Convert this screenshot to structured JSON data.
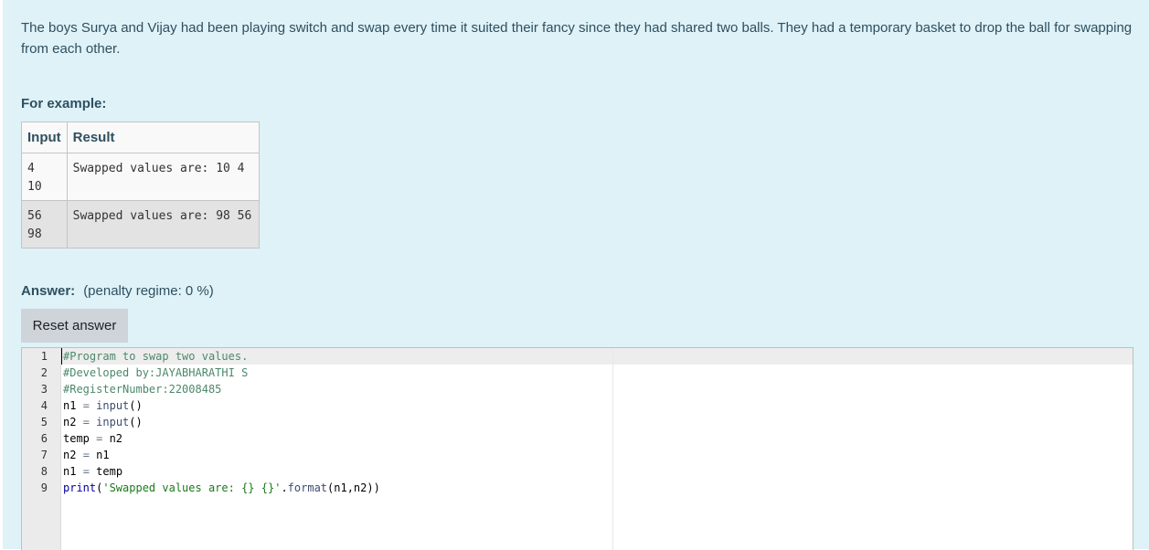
{
  "question": {
    "text": "The boys Surya and Vijay had been playing switch and swap every time it suited their fancy since they had shared two balls. They had a temporary basket to drop the ball for swapping from each other."
  },
  "examples": {
    "heading": "For example:",
    "col_input": "Input",
    "col_result": "Result",
    "rows": [
      {
        "input": "4\n10",
        "result": "Swapped values are: 10 4"
      },
      {
        "input": "56\n98",
        "result": "Swapped values are: 98 56"
      }
    ]
  },
  "answer": {
    "label": "Answer:",
    "penalty": "(penalty regime: 0 %)",
    "reset_label": "Reset answer"
  },
  "editor": {
    "lines": [
      {
        "num": "1",
        "tokens": [
          [
            "tk-comment",
            "#Program to swap two values."
          ]
        ]
      },
      {
        "num": "2",
        "tokens": [
          [
            "tk-comment",
            "#Developed by:JAYABHARATHI S"
          ]
        ]
      },
      {
        "num": "3",
        "tokens": [
          [
            "tk-comment",
            "#RegisterNumber:22008485"
          ]
        ]
      },
      {
        "num": "4",
        "tokens": [
          [
            "",
            "n1 "
          ],
          [
            "tk-op",
            "="
          ],
          [
            "",
            " "
          ],
          [
            "tk-builtin",
            "input"
          ],
          [
            "",
            "()"
          ]
        ]
      },
      {
        "num": "5",
        "tokens": [
          [
            "",
            "n2 "
          ],
          [
            "tk-op",
            "="
          ],
          [
            "",
            " "
          ],
          [
            "tk-builtin",
            "input"
          ],
          [
            "",
            "()"
          ]
        ]
      },
      {
        "num": "6",
        "tokens": [
          [
            "",
            "temp "
          ],
          [
            "tk-op",
            "="
          ],
          [
            "",
            " n2"
          ]
        ]
      },
      {
        "num": "7",
        "tokens": [
          [
            "",
            "n2 "
          ],
          [
            "tk-op",
            "="
          ],
          [
            "",
            " n1"
          ]
        ]
      },
      {
        "num": "8",
        "tokens": [
          [
            "",
            "n1 "
          ],
          [
            "tk-op",
            "="
          ],
          [
            "",
            " temp"
          ]
        ]
      },
      {
        "num": "9",
        "tokens": [
          [
            "tk-kw",
            "print"
          ],
          [
            "",
            "("
          ],
          [
            "tk-str",
            "'Swapped values are: {} {}'"
          ],
          [
            "",
            "."
          ],
          [
            "tk-fn",
            "format"
          ],
          [
            "",
            "(n1,n2))"
          ]
        ]
      }
    ]
  }
}
